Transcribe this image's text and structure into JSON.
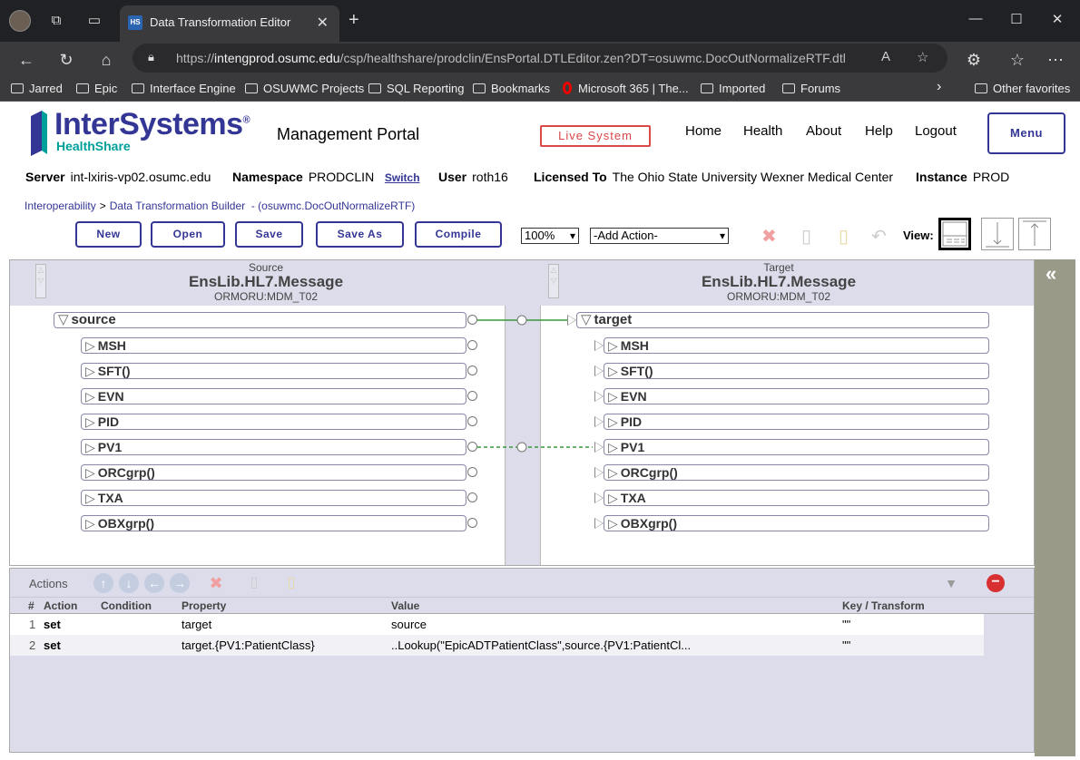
{
  "browser": {
    "tab_title": "Data Transformation Editor",
    "tab_favicon": "HS",
    "url_prefix": "https://",
    "url_host": "intengprod.osumc.edu",
    "url_path": "/csp/healthshare/prodclin/EnsPortal.DTLEditor.zen?DT=osuwmc.DocOutNormalizeRTF.dtl",
    "bookmarks": [
      "Jarred",
      "Epic",
      "Interface Engine",
      "OSUWMC Projects",
      "SQL Reporting",
      "Bookmarks",
      "Microsoft 365 | The...",
      "Imported",
      "Forums"
    ],
    "other_favorites": "Other favorites"
  },
  "header": {
    "logo_name": "InterSystems",
    "logo_sub": "HealthShare",
    "logo_registered": "®",
    "portal_title": "Management Portal",
    "live_system": "Live System",
    "nav": [
      "Home",
      "Health",
      "About",
      "Help",
      "Logout"
    ],
    "menu": "Menu",
    "server_label": "Server",
    "server_value": "int-lxiris-vp02.osumc.edu",
    "namespace_label": "Namespace",
    "namespace_value": "PRODCLIN",
    "switch": "Switch",
    "user_label": "User",
    "user_value": "roth16",
    "licensed_label": "Licensed To",
    "licensed_value": "The Ohio State University Wexner Medical Center",
    "instance_label": "Instance",
    "instance_value": "PROD"
  },
  "breadcrumb": {
    "item1": "Interoperability",
    "sep": ">",
    "item2": "Data Transformation Builder",
    "item3": "- (osuwmc.DocOutNormalizeRTF)"
  },
  "toolbar": {
    "new": "New",
    "open": "Open",
    "save": "Save",
    "save_as": "Save As",
    "compile": "Compile",
    "zoom": "100%",
    "add_action": "-Add Action-",
    "view_label": "View:"
  },
  "source": {
    "label": "Source",
    "class": "EnsLib.HL7.Message",
    "doctype": "ORMORU:MDM_T02",
    "root": "source",
    "segments": [
      "MSH",
      "SFT()",
      "EVN",
      "PID",
      "PV1",
      "ORCgrp()",
      "TXA",
      "OBXgrp()"
    ]
  },
  "target": {
    "label": "Target",
    "class": "EnsLib.HL7.Message",
    "doctype": "ORMORU:MDM_T02",
    "root": "target",
    "segments": [
      "MSH",
      "SFT()",
      "EVN",
      "PID",
      "PV1",
      "ORCgrp()",
      "TXA",
      "OBXgrp()"
    ]
  },
  "actions": {
    "label": "Actions",
    "columns": [
      "#",
      "Action",
      "Condition",
      "Property",
      "Value",
      "Key / Transform"
    ],
    "rows": [
      {
        "num": "1",
        "action": "set",
        "condition": "",
        "property": "target",
        "value": "source",
        "key": "\"\""
      },
      {
        "num": "2",
        "action": "set",
        "condition": "",
        "property": "target.{PV1:PatientClass}",
        "value": "..Lookup(\"EpicADTPatientClass\",source.{PV1:PatientCl...",
        "key": "\"\""
      }
    ]
  },
  "colors": {
    "brand": "#333695",
    "accent_teal": "#00a09a",
    "live_red": "#da4848",
    "panel_bg": "#dcdcea",
    "connector_green": "#3a9a3a"
  }
}
